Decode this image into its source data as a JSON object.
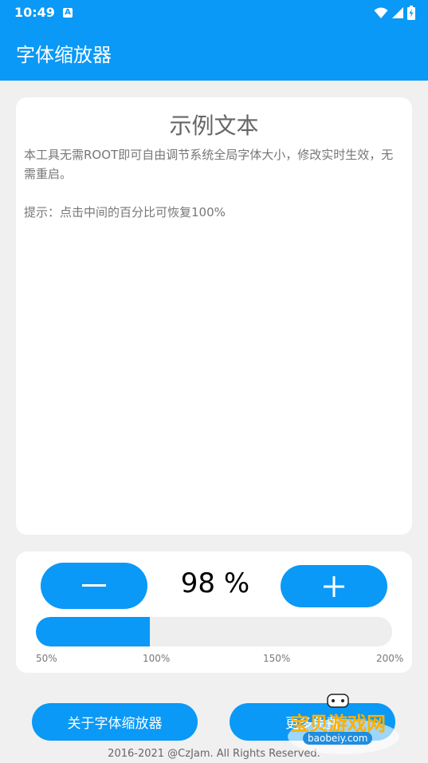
{
  "status_bar": {
    "time": "10:49",
    "notif_badge": "A",
    "icons": [
      "wifi-icon",
      "signal-icon",
      "battery-icon"
    ]
  },
  "app_bar": {
    "title": "字体缩放器"
  },
  "sample_card": {
    "title": "示例文本",
    "description": "本工具无需ROOT即可自由调节系统全局字体大小，修改实时生效，无需重启。",
    "hint": "提示：点击中间的百分比可恢复100%"
  },
  "controls": {
    "minus_label": "−",
    "plus_label": "+",
    "percent_text": "98 %",
    "percent_value": 98,
    "scale_min": 50,
    "scale_max": 200,
    "ticks": [
      "50%",
      "100%",
      "150%",
      "200%"
    ]
  },
  "buttons": {
    "about_label": "关于字体缩放器",
    "more_label": "更多免费"
  },
  "footer": {
    "copyright": "2016-2021 @CzJam. All Rights Reserved."
  },
  "watermark": {
    "site": "宝贝游戏网",
    "domain": "baobeiy.com"
  },
  "colors": {
    "accent": "#0a99f6",
    "background": "#f0f0f0",
    "card": "#ffffff"
  }
}
